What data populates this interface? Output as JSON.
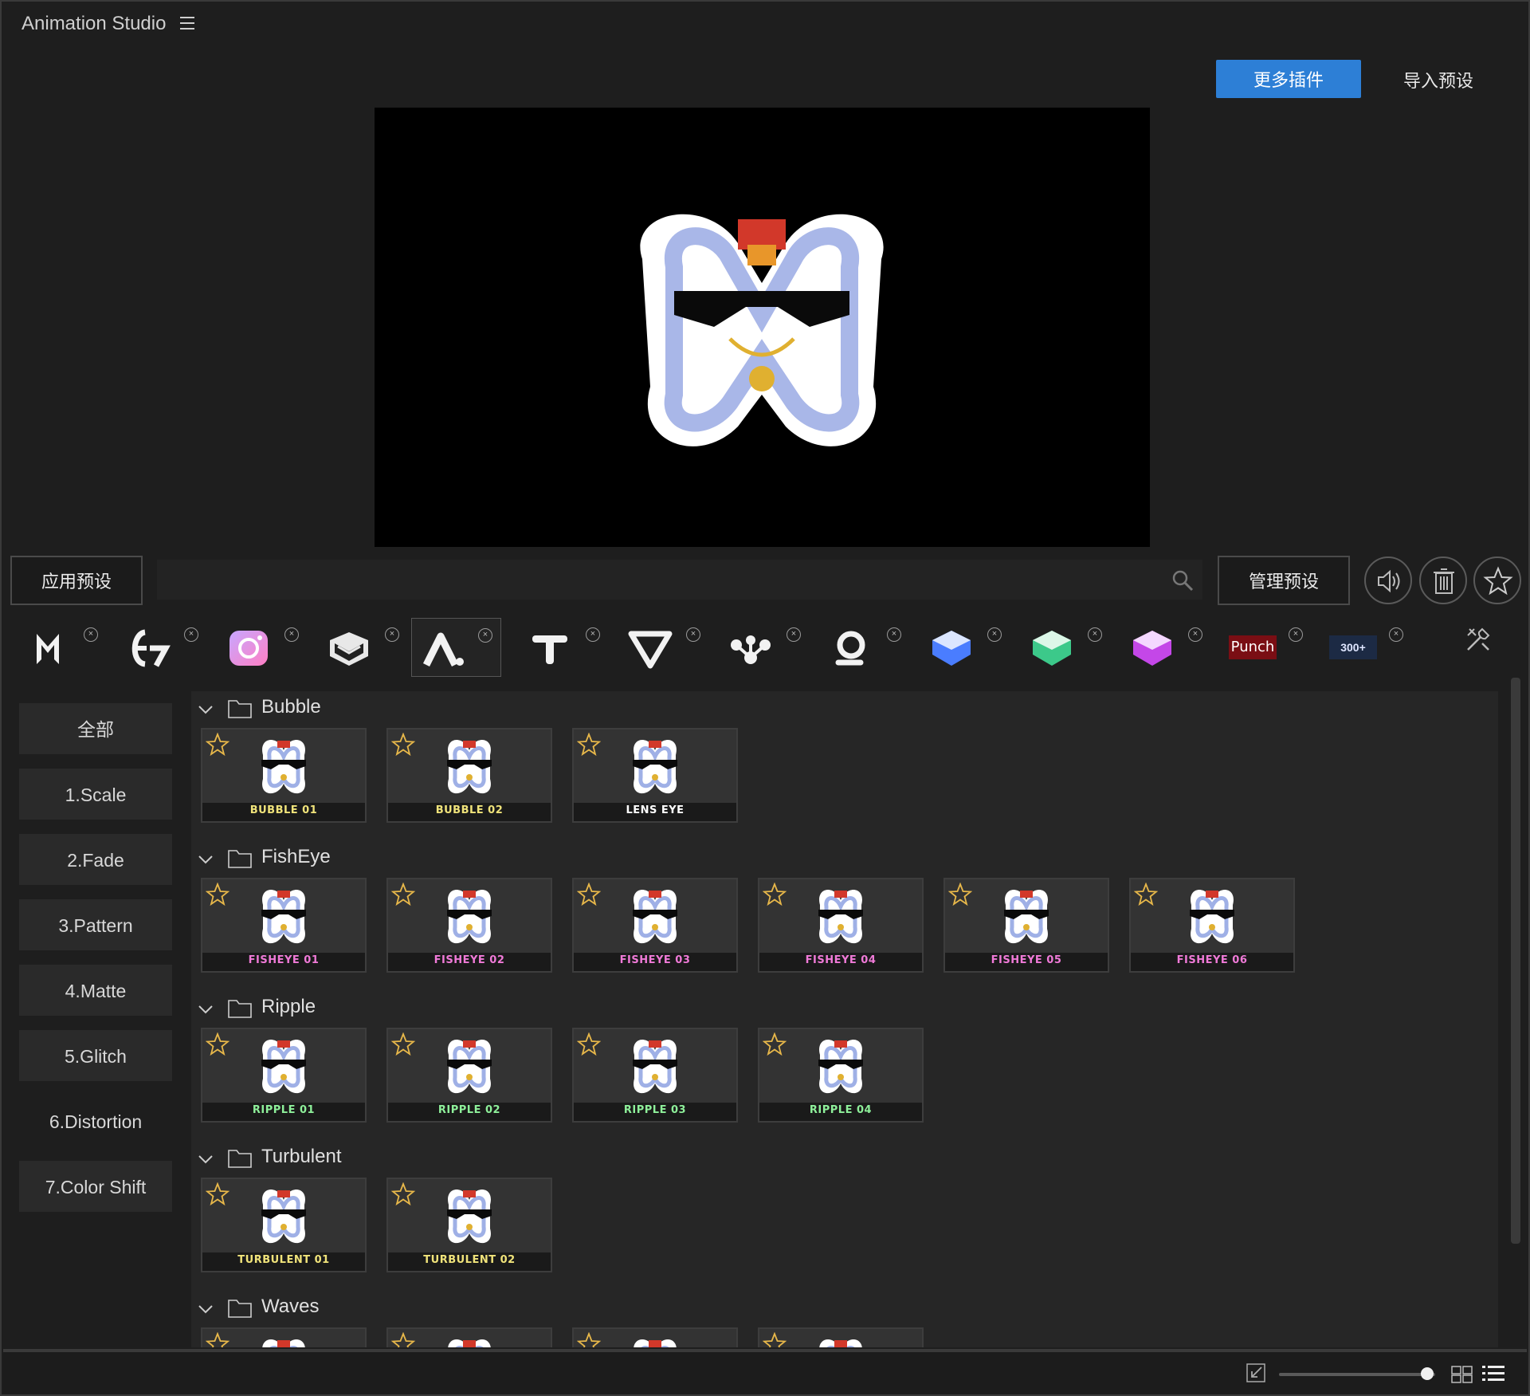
{
  "app": {
    "title": "Animation Studio"
  },
  "header": {
    "more_plugins": "更多插件",
    "import_preset": "导入预设"
  },
  "controls": {
    "apply_preset": "应用预设",
    "search_value": "",
    "manage_preset": "管理预设"
  },
  "plugins": [
    {
      "name": "m-logo-icon"
    },
    {
      "name": "e7-logo-icon"
    },
    {
      "name": "camera-logo-icon"
    },
    {
      "name": "layers-logo-icon"
    },
    {
      "name": "a-logo-icon",
      "active": true
    },
    {
      "name": "t-logo-icon"
    },
    {
      "name": "v-logo-icon"
    },
    {
      "name": "nodes-logo-icon"
    },
    {
      "name": "ring-logo-icon"
    },
    {
      "name": "blue-cube-icon"
    },
    {
      "name": "green-cube-icon"
    },
    {
      "name": "pink-cube-icon"
    },
    {
      "name": "punch-logo",
      "label": "Punch"
    },
    {
      "name": "banner-logo",
      "label": "300+"
    }
  ],
  "sidebar": {
    "items": [
      "全部",
      "1.Scale",
      "2.Fade",
      "3.Pattern",
      "4.Matte",
      "5.Glitch",
      "6.Distortion",
      "7.Color Shift"
    ]
  },
  "groups": [
    {
      "name": "Bubble",
      "items": [
        {
          "label": "BUBBLE 01",
          "color": "#f0e37a"
        },
        {
          "label": "BUBBLE 02",
          "color": "#f0e37a"
        },
        {
          "label": "LENS EYE",
          "color": "#ffffff"
        }
      ]
    },
    {
      "name": "FishEye",
      "items": [
        {
          "label": "FISHEYE 01",
          "color": "#f07ad8"
        },
        {
          "label": "FISHEYE 02",
          "color": "#f07ad8"
        },
        {
          "label": "FISHEYE 03",
          "color": "#f07ad8"
        },
        {
          "label": "FISHEYE 04",
          "color": "#f07ad8"
        },
        {
          "label": "FISHEYE 05",
          "color": "#f07ad8"
        },
        {
          "label": "FISHEYE 06",
          "color": "#f07ad8"
        }
      ]
    },
    {
      "name": "Ripple",
      "items": [
        {
          "label": "RIPPLE 01",
          "color": "#8ef09a"
        },
        {
          "label": "RIPPLE 02",
          "color": "#8ef09a"
        },
        {
          "label": "RIPPLE 03",
          "color": "#8ef09a"
        },
        {
          "label": "RIPPLE 04",
          "color": "#8ef09a"
        }
      ]
    },
    {
      "name": "Turbulent",
      "items": [
        {
          "label": "TURBULENT 01",
          "color": "#f0e37a"
        },
        {
          "label": "TURBULENT 02",
          "color": "#f0e37a"
        }
      ]
    },
    {
      "name": "Waves",
      "items": [
        {
          "label": "",
          "color": "#ffffff"
        },
        {
          "label": "",
          "color": "#ffffff"
        },
        {
          "label": "",
          "color": "#ffffff"
        },
        {
          "label": "",
          "color": "#ffffff"
        }
      ]
    }
  ],
  "footer": {
    "zoom_level": 0.95
  },
  "colors": {
    "accent": "#2d7fd6",
    "star": "#e8b84a"
  }
}
